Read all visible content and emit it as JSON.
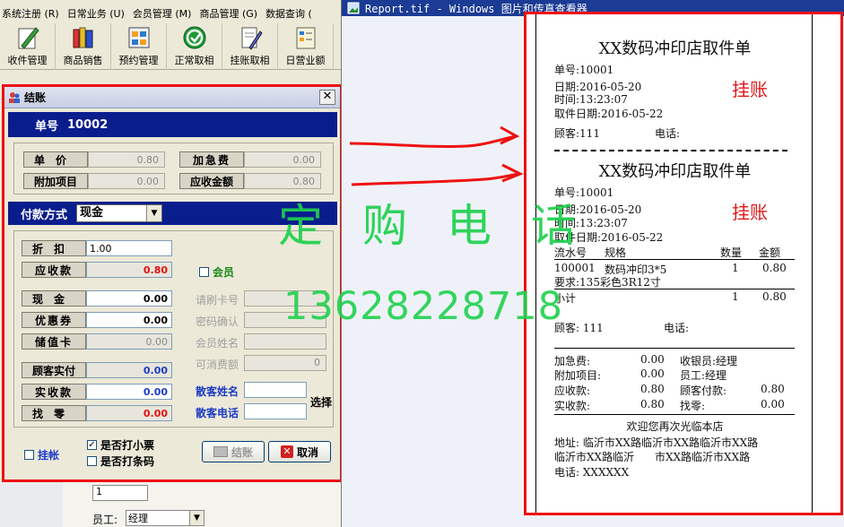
{
  "menu": [
    "系统注册 (R)",
    "日常业务 (U)",
    "会员管理 (M)",
    "商品管理 (G)",
    "数据查询 ("
  ],
  "toolbar": [
    "收件管理",
    "商品销售",
    "预约管理",
    "正常取相",
    "挂账取相",
    "日营业额"
  ],
  "dialog": {
    "title": "结账",
    "close": "✕",
    "order_label": "单号",
    "order_no": "10002",
    "fees": [
      {
        "label": "单价",
        "value": "0.80"
      },
      {
        "label": "加急费",
        "value": "0.00"
      },
      {
        "label": "附加项目",
        "value": "0.00"
      },
      {
        "label": "应收金额",
        "value": "0.80"
      }
    ],
    "pay_method_label": "付款方式",
    "pay_method": "现金",
    "discount_label": "折扣",
    "discount": "1.00",
    "receivable_label": "应收款",
    "receivable": "0.80",
    "member_label": "会员",
    "cash_label": "现金",
    "cash": "0.00",
    "coupon_label": "优惠券",
    "coupon": "0.00",
    "stored_label": "储值卡",
    "stored": "0.00",
    "paid_label": "顾客实付",
    "paid": "0.00",
    "actual_label": "实收款",
    "actual": "0.00",
    "change_label": "找零",
    "change": "0.00",
    "card_no_label": "请刷卡号",
    "pwd_label": "密码确认",
    "member_name_label": "会员姓名",
    "credit_label": "可消费额",
    "credit": "0",
    "guest_name_label": "散客姓名",
    "guest_phone_label": "散客电话",
    "select_label": "选择",
    "credit_chk": "挂帐",
    "print_receipt": "是否打小票",
    "print_barcode": "是否打条码",
    "checkout_btn": "结账",
    "cancel_btn": "取消"
  },
  "below": {
    "input_value": "1",
    "employee_label": "员工:",
    "employee": "经理"
  },
  "viewer": {
    "title": "Report.tif - Windows 图片和传真查看器"
  },
  "receipt1": {
    "title": "XX数码冲印店取件单",
    "order": "单号:10001",
    "date": "日期:2016-05-20",
    "time": "时间:13:23:07",
    "pickup": "取件日期:2016-05-22",
    "customer": "顾客:111",
    "phone": "电话:",
    "stamp": "挂账"
  },
  "receipt2": {
    "title": "XX数码冲印店取件单",
    "order": "单号:10001",
    "date": "日期:2016-05-20",
    "time": "时间:13:23:07",
    "pickup": "取件日期:2016-05-22",
    "stamp": "挂账",
    "col_serial": "流水号",
    "col_spec": "规格",
    "col_qty": "数量",
    "col_amount": "金额",
    "item_serial": "100001",
    "item_name": "数码冲印3*5",
    "item_qty": "1",
    "item_amount": "0.80",
    "item_note": "要求:135彩色3R12寸",
    "subtotal_label": "小计",
    "subtotal_qty": "1",
    "subtotal_amount": "0.80",
    "customer": "顾客: 111",
    "phone": "电话:",
    "urgent": "加急费:",
    "urgent_v": "0.00",
    "cashier": "收银员:经理",
    "extra": "附加项目:",
    "extra_v": "0.00",
    "staff": "员工:经理",
    "receivable": "应收款:",
    "receivable_v": "0.80",
    "cust_paid": "顾客付款:",
    "cust_paid_v": "0.80",
    "actual": "实收款:",
    "actual_v": "0.80",
    "change": "找零:",
    "change_v": "0.00",
    "welcome": "欢迎您再次光临本店",
    "address1": "地址: 临沂市XX路临沂市XX路临沂市XX路",
    "address2": "临沂市XX路临沂      市XX路临沂市XX路",
    "tel": "电话: XXXXXX"
  },
  "watermark": {
    "text": "定购电话",
    "phone": "13628228718"
  },
  "colors": {
    "dialog_border": "#ee1111",
    "header_bar": "#0a1d8c",
    "watermark": "#1fd14e",
    "stamp": "#e01818"
  }
}
